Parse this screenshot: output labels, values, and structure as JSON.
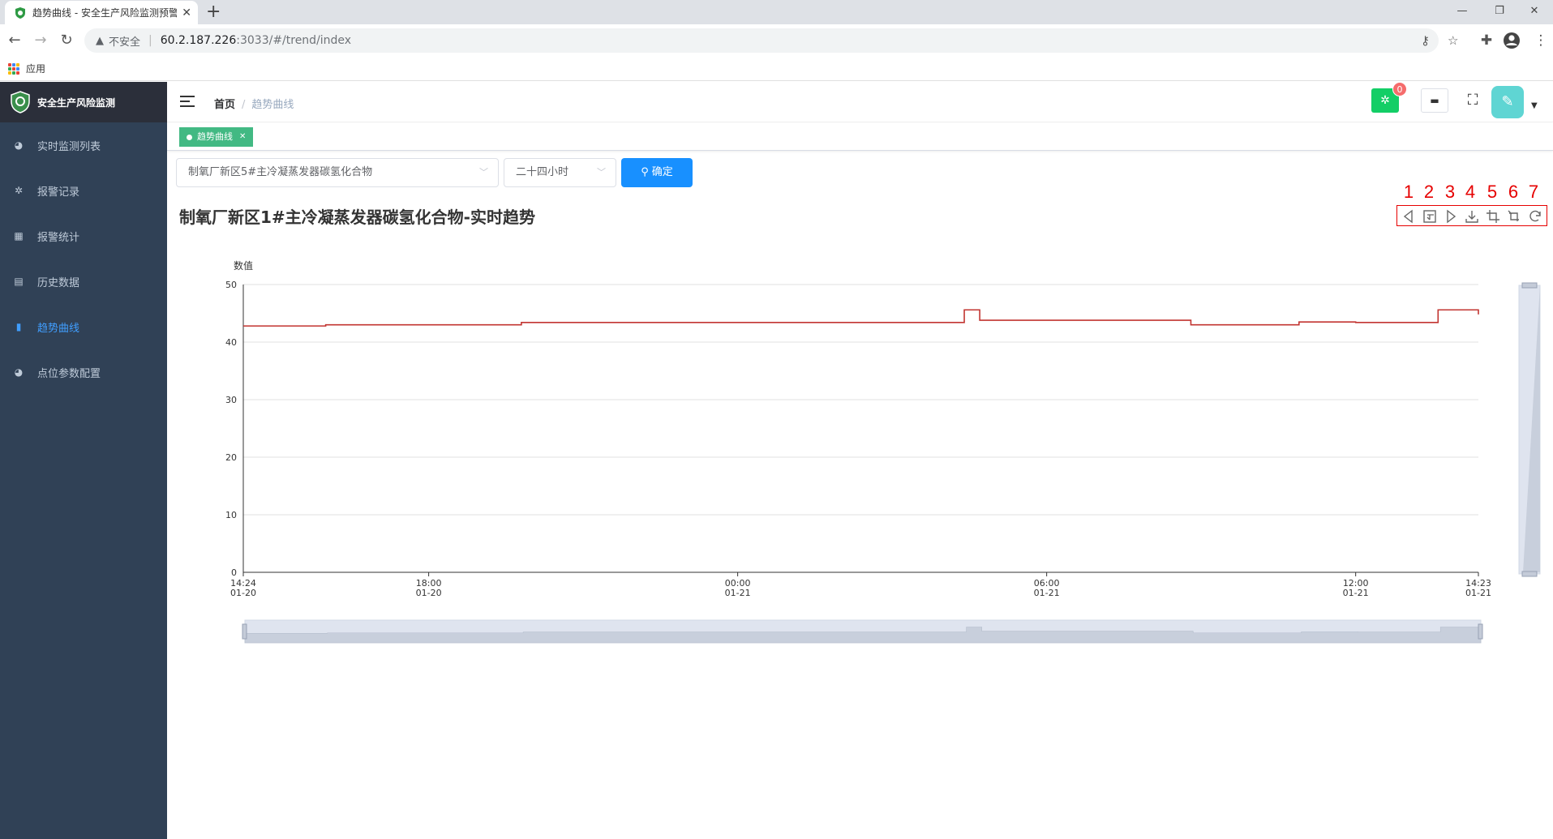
{
  "browser": {
    "tab_title": "趋势曲线 - 安全生产风险监测预警",
    "insecure_label": "不安全",
    "url_host": "60.2.187.226",
    "url_rest": ":3033/#/trend/index",
    "bookmark_apps": "应用"
  },
  "app": {
    "logo_title": "安全生产风险监测",
    "sidebar": [
      {
        "label": "实时监测列表",
        "icon": "dashboard-icon"
      },
      {
        "label": "报警记录",
        "icon": "bug-icon"
      },
      {
        "label": "报警统计",
        "icon": "table-icon"
      },
      {
        "label": "历史数据",
        "icon": "document-icon"
      },
      {
        "label": "趋势曲线",
        "icon": "chart-icon"
      },
      {
        "label": "点位参数配置",
        "icon": "dashboard-icon"
      }
    ],
    "active_index": 4,
    "breadcrumb": {
      "home": "首页",
      "current": "趋势曲线"
    },
    "bug_count": "0",
    "tag_label": "趋势曲线"
  },
  "filters": {
    "point_value": "制氧厂新区5#主冷凝蒸发器碳氢化合物",
    "range_value": "二十四小时",
    "confirm_label": "确定"
  },
  "toolbox_numbers": [
    "1",
    "2",
    "3",
    "4",
    "5",
    "6",
    "7"
  ],
  "colors": {
    "series": "#c23531",
    "accent": "#1890ff",
    "sidebar": "#304156",
    "tag": "#42b983"
  },
  "chart_data": {
    "type": "line",
    "title": "制氧厂新区1#主冷凝蒸发器碳氢化合物-实时趋势",
    "ylabel": "数值",
    "ylim": [
      0,
      50
    ],
    "yticks": [
      "0",
      "10",
      "20",
      "30",
      "40",
      "50"
    ],
    "xticks": [
      {
        "time": "14:24",
        "date": "01-20",
        "hours": 0
      },
      {
        "time": "18:00",
        "date": "01-20",
        "hours": 3.6
      },
      {
        "time": "00:00",
        "date": "01-21",
        "hours": 9.6
      },
      {
        "time": "06:00",
        "date": "01-21",
        "hours": 15.6
      },
      {
        "time": "12:00",
        "date": "01-21",
        "hours": 21.6
      },
      {
        "time": "14:23",
        "date": "01-21",
        "hours": 23.983
      }
    ],
    "series": [
      {
        "x": [
          0,
          0.25,
          1.6,
          3.6,
          5.4,
          9.6,
          13.6,
          14.0,
          14.3,
          18.4,
          20.5,
          21.6,
          23.2,
          23.983
        ],
        "values": [
          42.8,
          42.8,
          43.0,
          43.0,
          43.4,
          43.4,
          43.4,
          45.6,
          43.8,
          43.0,
          43.5,
          43.4,
          45.6,
          44.8
        ]
      }
    ]
  }
}
